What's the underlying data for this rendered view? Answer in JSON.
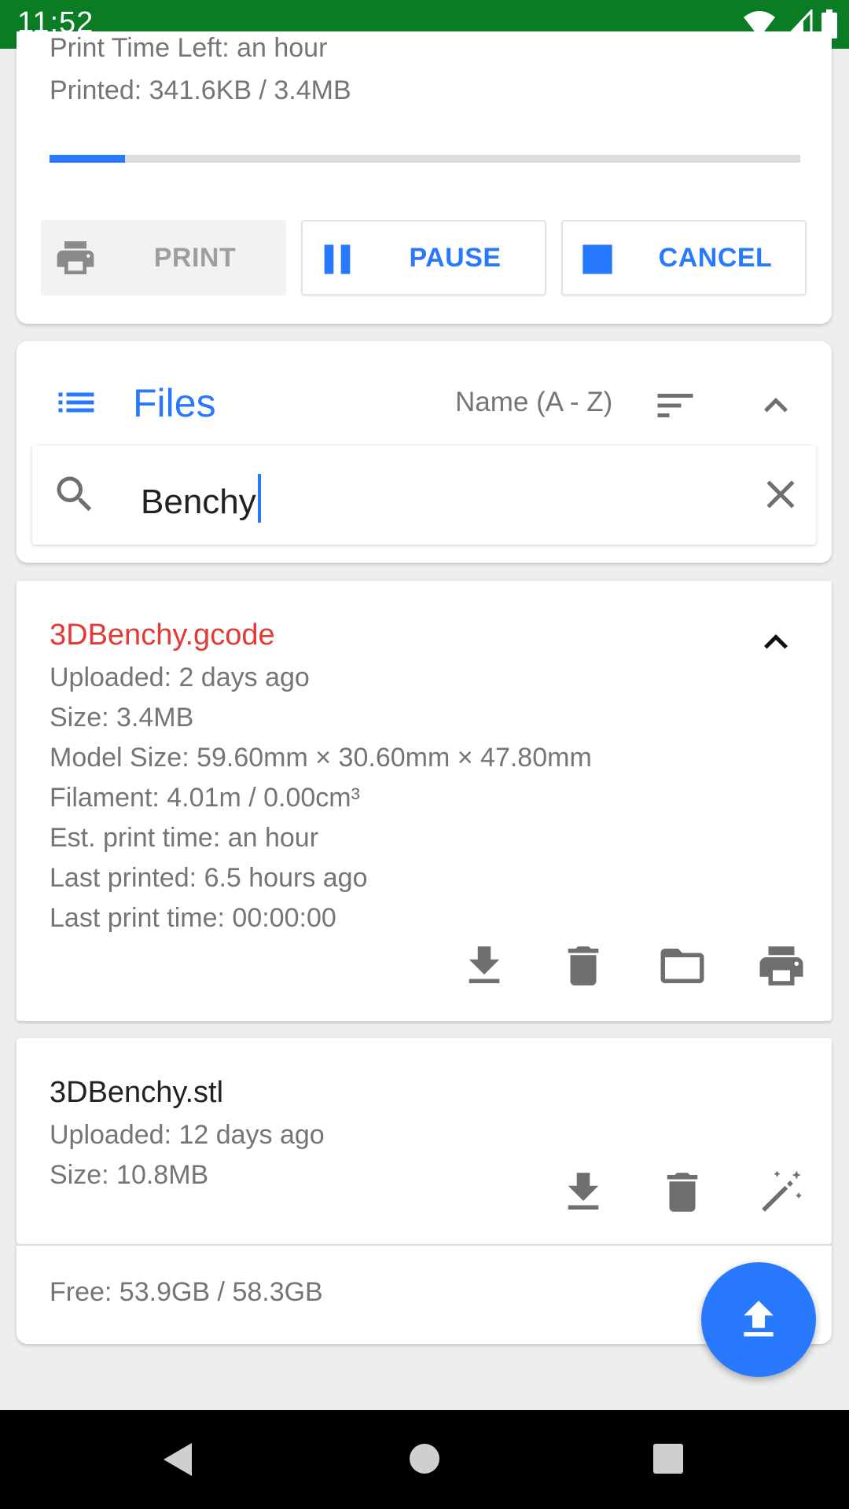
{
  "status_bar": {
    "time": "11:52"
  },
  "job": {
    "time_left": "Print Time Left: an hour",
    "printed": "Printed: 341.6KB / 3.4MB",
    "progress_percent": 10,
    "buttons": {
      "print": "PRINT",
      "pause": "PAUSE",
      "cancel": "CANCEL"
    }
  },
  "files_panel": {
    "title": "Files",
    "sort_label": "Name (A - Z)",
    "search": {
      "value": "Benchy"
    }
  },
  "files": [
    {
      "name": "3DBenchy.gcode",
      "name_color": "#e53935",
      "details": [
        "Uploaded: 2 days ago",
        "Size: 3.4MB",
        "Model Size: 59.60mm × 30.60mm × 47.80mm",
        "Filament: 4.01m / 0.00cm³",
        "Est. print time: an hour",
        "Last printed: 6.5 hours ago",
        "Last print time: 00:00:00"
      ],
      "actions": [
        "download-icon",
        "trash-icon",
        "folder-icon",
        "printer-icon"
      ]
    },
    {
      "name": "3DBenchy.stl",
      "name_color": "#212121",
      "details": [
        "Uploaded: 12 days ago",
        "Size: 10.8MB"
      ],
      "actions": [
        "download-icon",
        "trash-icon",
        "magic-wand-icon"
      ]
    }
  ],
  "storage": {
    "free": "Free: 53.9GB / 58.3GB"
  },
  "colors": {
    "accent": "#2979ff",
    "status_bar": "#0a7d24"
  }
}
